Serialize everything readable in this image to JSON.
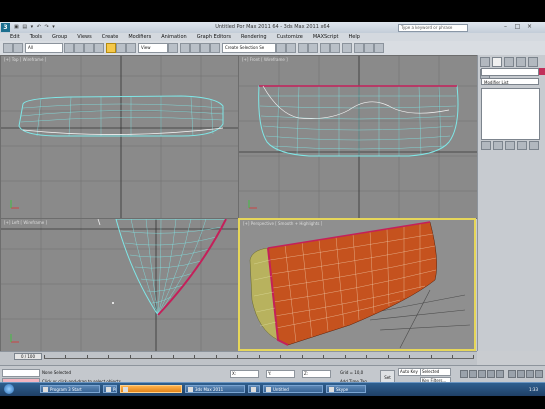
{
  "window": {
    "title": "Untitled Por Max 2011 64 - 3ds Max 2011 x64",
    "search_placeholder": "Type a keyword or phrase",
    "quick_access": "▣ ▤ ▾ ↶ ↷ ▾"
  },
  "menu": [
    "Edit",
    "Tools",
    "Group",
    "Views",
    "Create",
    "Modifiers",
    "Animation",
    "Graph Editors",
    "Rendering",
    "Customize",
    "MAXScript",
    "Help"
  ],
  "toolbar": {
    "selection_filter": "All",
    "ref_coord": "View",
    "named_selection": "Create Selection Se"
  },
  "viewports": {
    "top": "[+] Top [ Wireframe ]",
    "front": "[+] Front [ Wireframe ]",
    "left": "[+] Left [ Wireframe ]",
    "perspective": "[+] Perspective [ Smooth + Highlights ]"
  },
  "command_panel": {
    "modifier_list": "Modifier List"
  },
  "timeline": {
    "frame": "0 / 100",
    "ticks": [
      "0",
      "5",
      "10",
      "15",
      "20",
      "25",
      "30",
      "35",
      "40",
      "45",
      "50",
      "55",
      "60",
      "65",
      "70",
      "75",
      "80",
      "85",
      "90",
      "95",
      "100"
    ]
  },
  "status": {
    "selection": "None Selected",
    "prompt": "Click or click-and-drag to select objects",
    "x": "X:",
    "y": "Y:",
    "z": "Z:",
    "grid": "Grid = 10,0",
    "add_time_tag": "Add Time Tag",
    "auto_key": "Auto Key",
    "set_key": "Set Key",
    "key_filters": "Key Filters...",
    "selected": "Selected"
  },
  "taskbar": {
    "items": [
      "Program 3 Start",
      "Program 4",
      "",
      "3ds Max 2011",
      "",
      "Untitled",
      "Skype",
      ""
    ],
    "clock": "1:33"
  },
  "colors": {
    "viewport_bg": "#8a8a8a",
    "active_border": "#e6d65a",
    "wire": "#7fe7e7",
    "mesh_fill": "#c5521e",
    "edge_highlight": "#c4205a"
  }
}
